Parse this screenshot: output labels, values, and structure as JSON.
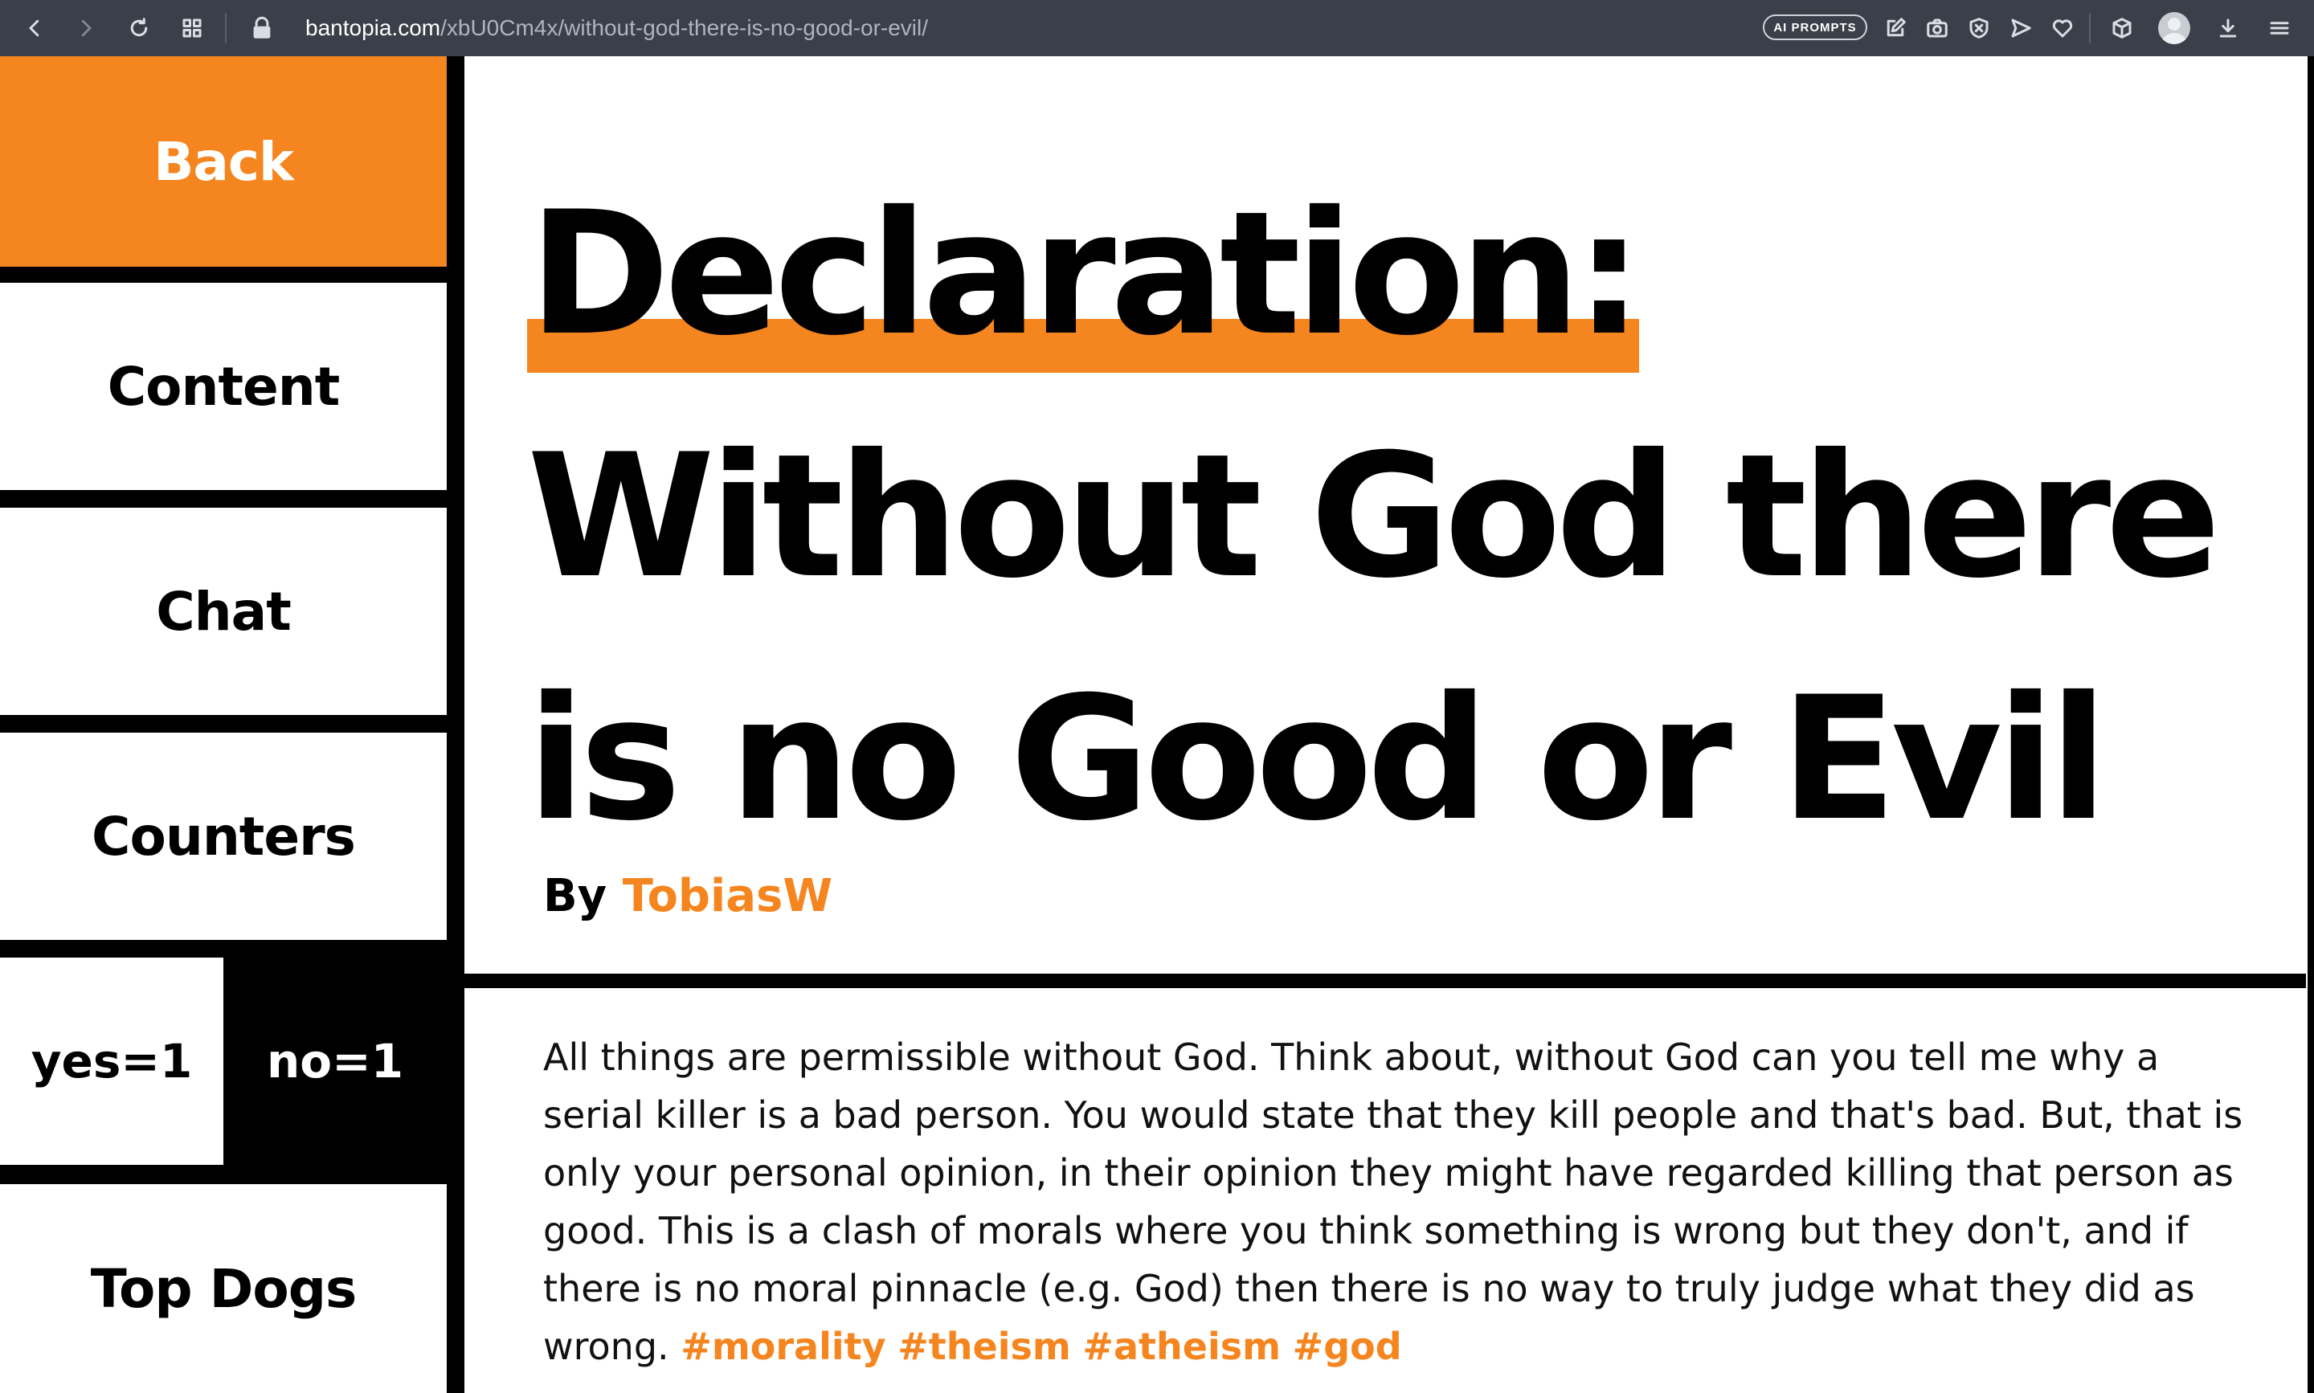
{
  "browser": {
    "url_domain": "bantopia.com",
    "url_path": "/xbU0Cm4x/without-god-there-is-no-good-or-evil/",
    "ai_prompts_label": "AI PROMPTS"
  },
  "sidebar": {
    "back_label": "Back",
    "content_label": "Content",
    "chat_label": "Chat",
    "counters_label": "Counters",
    "yes_label": "yes=1",
    "no_label": "no=1",
    "top_dogs_label": "Top Dogs"
  },
  "article": {
    "title_highlight": "Declaration:",
    "title_rest": "Without God there is no Good or Evil",
    "by_label": "By",
    "author": "TobiasW",
    "body": "All things are permissible without God. Think about, without God can you tell me why a serial killer is a bad person. You would state that they kill people and that's bad. But, that is only your personal opinion, in their opinion they might have regarded killing that person as good. This is a clash of morals where you think something is wrong but they don't, and if there is no moral pinnacle (e.g. God) then there is no way to truly judge what they did as wrong.",
    "tags": [
      "#morality",
      "#theism",
      "#atheism",
      "#god"
    ]
  },
  "colors": {
    "accent": "#f5851f",
    "chrome": "#3a3f49",
    "text": "#000000"
  }
}
